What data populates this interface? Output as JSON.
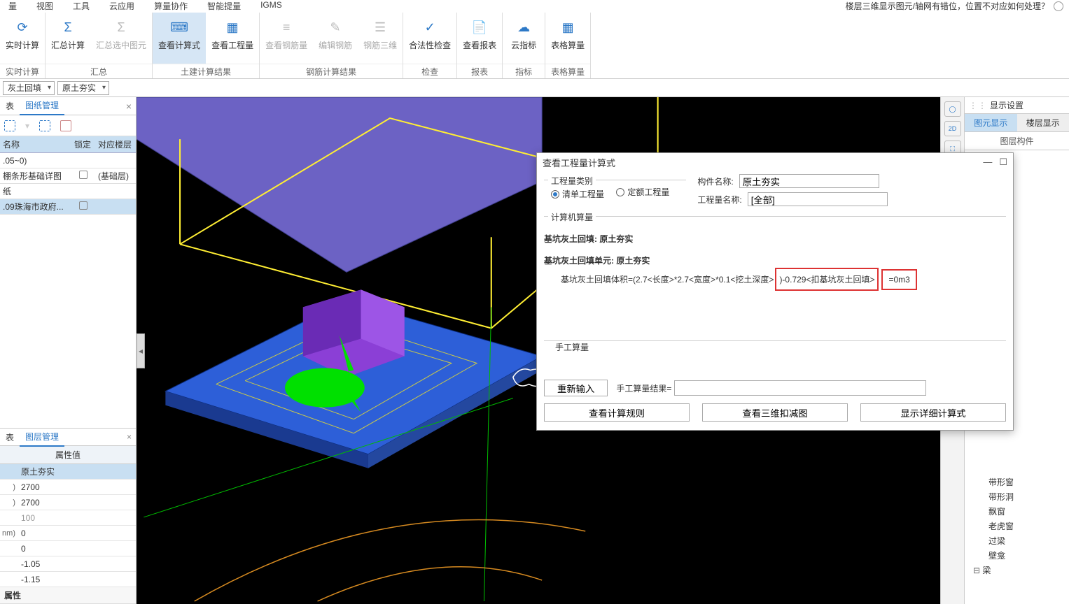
{
  "topmenu": [
    "量",
    "视图",
    "工具",
    "云应用",
    "算量协作",
    "智能提量",
    "IGMS"
  ],
  "topQuery": "楼层三维显示图元/轴网有错位，位置不对应如何处理？",
  "ribbon": [
    {
      "label": "实时计算",
      "buttons": [
        {
          "label": "实时计算",
          "icon": "⟳"
        }
      ]
    },
    {
      "label": "汇总",
      "buttons": [
        {
          "label": "汇总计算",
          "icon": "Σ"
        },
        {
          "label": "汇总选中图元",
          "icon": "Σ",
          "disabled": true
        }
      ]
    },
    {
      "label": "土建计算结果",
      "buttons": [
        {
          "label": "查看计算式",
          "icon": "⌨",
          "active": true
        },
        {
          "label": "查看工程量",
          "icon": "▦"
        }
      ]
    },
    {
      "label": "钢筋计算结果",
      "buttons": [
        {
          "label": "查看钢筋量",
          "icon": "≡",
          "disabled": true
        },
        {
          "label": "编辑钢筋",
          "icon": "✎",
          "disabled": true
        },
        {
          "label": "钢筋三维",
          "icon": "☰",
          "disabled": true
        }
      ]
    },
    {
      "label": "检查",
      "buttons": [
        {
          "label": "合法性检查",
          "icon": "✓"
        }
      ]
    },
    {
      "label": "报表",
      "buttons": [
        {
          "label": "查看报表",
          "icon": "📄"
        }
      ]
    },
    {
      "label": "指标",
      "buttons": [
        {
          "label": "云指标",
          "icon": "☁"
        }
      ]
    },
    {
      "label": "表格算量",
      "buttons": [
        {
          "label": "表格算量",
          "icon": "▦"
        }
      ]
    }
  ],
  "subbar": {
    "c1": "灰土回填",
    "c2": "原土夯实"
  },
  "tabsLeft": {
    "t0": "表",
    "t1": "图纸管理"
  },
  "lhdr": {
    "c0": "名称",
    "c1": "锁定",
    "c2": "对应楼层"
  },
  "lrows": [
    {
      "name": ".05~0)",
      "lock": false,
      "floor": ""
    },
    {
      "name": "棚条形基础详图",
      "lock": true,
      "floor": "(基础层)"
    },
    {
      "name": "纸",
      "lock": false,
      "floor": ""
    },
    {
      "name": ".09珠海市政府...",
      "lock": true,
      "floor": "",
      "sel": true
    }
  ],
  "tabsLeft2": "图层管理",
  "propHdr": "属性值",
  "props": [
    {
      "lbl": "",
      "val": "原土夯实",
      "sel": true
    },
    {
      "lbl": ")",
      "val": "2700"
    },
    {
      "lbl": ")",
      "val": "2700"
    },
    {
      "lbl": "",
      "val": "100",
      "dis": true
    },
    {
      "lbl": "nm)",
      "val": "0"
    },
    {
      "lbl": "",
      "val": "0"
    },
    {
      "lbl": "",
      "val": "-1.05"
    },
    {
      "lbl": "",
      "val": "-1.15"
    }
  ],
  "propGroup": "属性",
  "vtools": [
    "◯",
    "2D",
    "⬚"
  ],
  "rightpanel": {
    "title": "显示设置",
    "tabs": [
      "图元显示",
      "楼层显示"
    ],
    "header": "图层构件",
    "treeItems": [
      "带形窗",
      "带形洞",
      "飘窗",
      "老虎窗",
      "过梁",
      "壁龛"
    ],
    "treeGroup": "梁"
  },
  "dialog": {
    "title": "查看工程量计算式",
    "qtyTypeLegend": "工程量类别",
    "radios": [
      "清单工程量",
      "定额工程量"
    ],
    "componentNameLabel": "构件名称:",
    "componentName": "原土夯实",
    "qtyNameLabel": "工程量名称:",
    "qtyName": "[全部]",
    "calcLegend": "计算机算量",
    "line1": "基坑灰土回填: 原土夯实",
    "line2": "基坑灰土回填单元: 原土夯实",
    "formulaPrefix": "基坑灰土回填体积=(2.7<长度>*2.7<宽度>*0.1<挖土深度>",
    "hl1": ")-0.729<扣基坑灰土回填>",
    "hl2": "=0m3",
    "manualLegend": "手工算量",
    "reenter": "重新输入",
    "manualResLabel": "手工算量结果=",
    "btns": [
      "查看计算规则",
      "查看三维扣减图",
      "显示详细计算式"
    ]
  }
}
